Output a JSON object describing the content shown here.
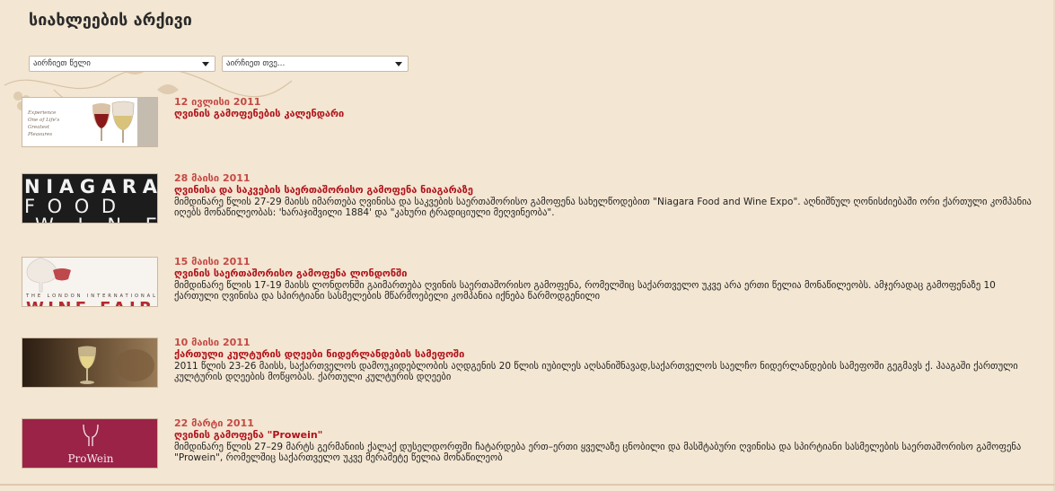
{
  "page": {
    "title": "სიახლეების არქივი"
  },
  "filters": {
    "year_select": "აირჩიეთ წელი",
    "month_select": "აირჩიეთ თვე..."
  },
  "news": [
    {
      "date": "12 ივლისი 2011",
      "title": "ღვინის გამოფენების კალენდარი",
      "description": "",
      "thumb_text": "Experience\nOne of Life's\nGreatest\nPleasures"
    },
    {
      "date": "28 მაისი 2011",
      "title": "ღვინისა და საკვების საერთაშორისო გამოფენა ნიაგარაზე",
      "description": "მიმდინარე წლის 27-29 მაისს იმართება ღვინისა და საკვების საერთაშორისო გამოფენა სახელწოდებით \"Niagara Food and Wine Expo\". აღნიშნულ ღონისძიებაში ორი ქართული კომპანია იღებს მონაწილეობას: 'ხარაჯიშვილი 1884' და \"კახური ტრადიციული მეღვინეობა\".",
      "thumb_text": "NIAGARA\nFOOD\nWINE"
    },
    {
      "date": "15 მაისი 2011",
      "title": "ღვინის საერთაშორისო გამოფენა ლონდონში",
      "description": "მიმდინარე წლის 17-19 მაისს ლონდონში გაიმართება ღვინის საერთაშორისო გამოფენა, რომელშიც საქართველო უკვე არა ერთი წელია მონაწილეობს. ამჯერადაც გამოფენაზე 10 ქართული ღვინისა და სპირტიანი სასმელების მწარმოებელი კომპანია იქნება წარმოდგენილი",
      "thumb_text": "THE LONDON INTERNATIONAL\nWINE FAIR"
    },
    {
      "date": "10 მაისი 2011",
      "title": "ქართული კულტურის დღეები ნიდერლანდების სამეფოში",
      "description": "2011 წლის 23-26 მაისს, საქართველოს დამოუკიდებლობის აღდგენის 20 წლის იუბილეს აღსანიშნავად,საქართველოს საელჩო ნიდერლანდების სამეფოში გეგმავს ქ. ჰააგაში ქართული კულტურის დღეების მოწყობას. ქართული კულტურის დღეები",
      "thumb_text": ""
    },
    {
      "date": "22 მარტი 2011",
      "title": "ღვინის გამოფენა \"Prowein\"",
      "description": "მიმდინარე წლის 27–29 მარტს გერმანიის ქალაქ დუსელდორფში ჩატარდება ერთ–ერთი ყველაზე ცნობილი და მასშტაბური ღვინისა და სპირტიანი სასმელების საერთაშორისო გამოფენა \"Prowein\", რომელშიც საქართველო უკვე მერამეტე წელია მონაწილეობ",
      "thumb_text": "ProWein"
    }
  ],
  "colors": {
    "background": "#f3e6d2",
    "date": "#c44a45",
    "title": "#b0121a",
    "prowein_bg": "#9a2347"
  }
}
